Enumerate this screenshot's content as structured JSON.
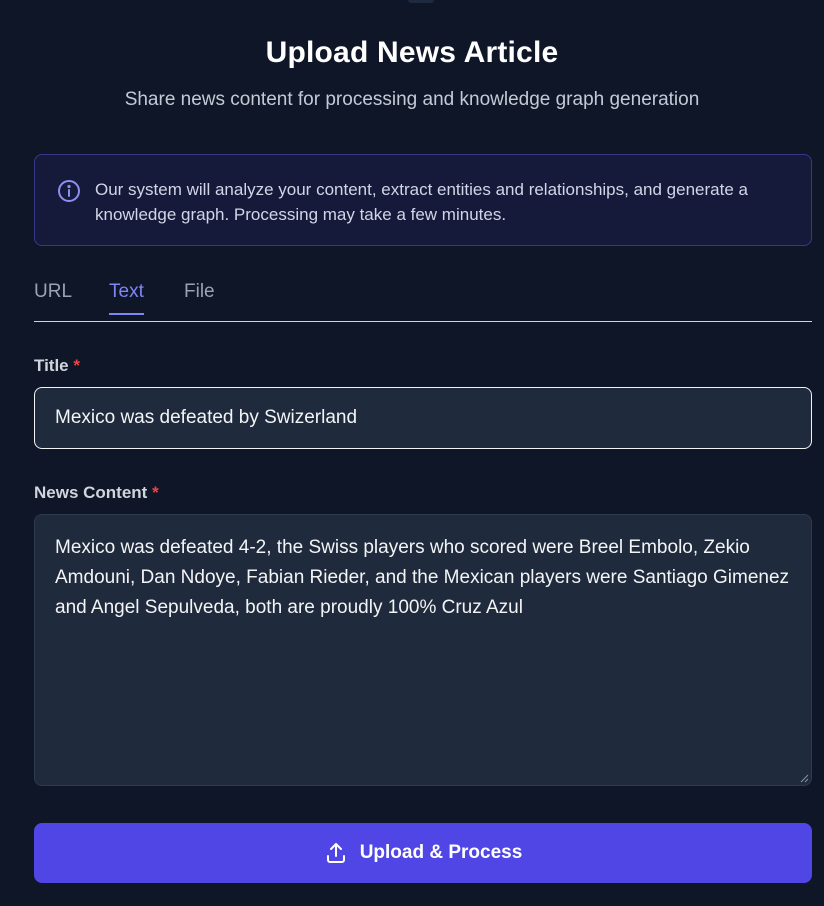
{
  "header": {
    "title": "Upload News Article",
    "subtitle": "Share news content for processing and knowledge graph generation"
  },
  "info": {
    "icon": "info-icon",
    "text": "Our system will analyze your content, extract entities and relationships, and generate a knowledge graph. Processing may take a few minutes."
  },
  "tabs": [
    {
      "label": "URL",
      "active": false
    },
    {
      "label": "Text",
      "active": true
    },
    {
      "label": "File",
      "active": false
    }
  ],
  "form": {
    "title_label": "Title",
    "content_label": "News Content",
    "required_marker": "*",
    "title_value": "Mexico was defeated by Swizerland",
    "content_value": "Mexico was defeated 4-2, the Swiss players who scored were Breel Embolo, Zekio Amdouni, Dan Ndoye, Fabian Rieder, and the Mexican players were Santiago Gimenez and Angel Sepulveda, both are proudly 100% Cruz Azul"
  },
  "submit": {
    "label": "Upload & Process",
    "icon": "upload-icon"
  },
  "colors": {
    "background": "#0e1628",
    "accent": "#4f46e5",
    "active_tab": "#7f85f5",
    "required": "#ef4444"
  }
}
